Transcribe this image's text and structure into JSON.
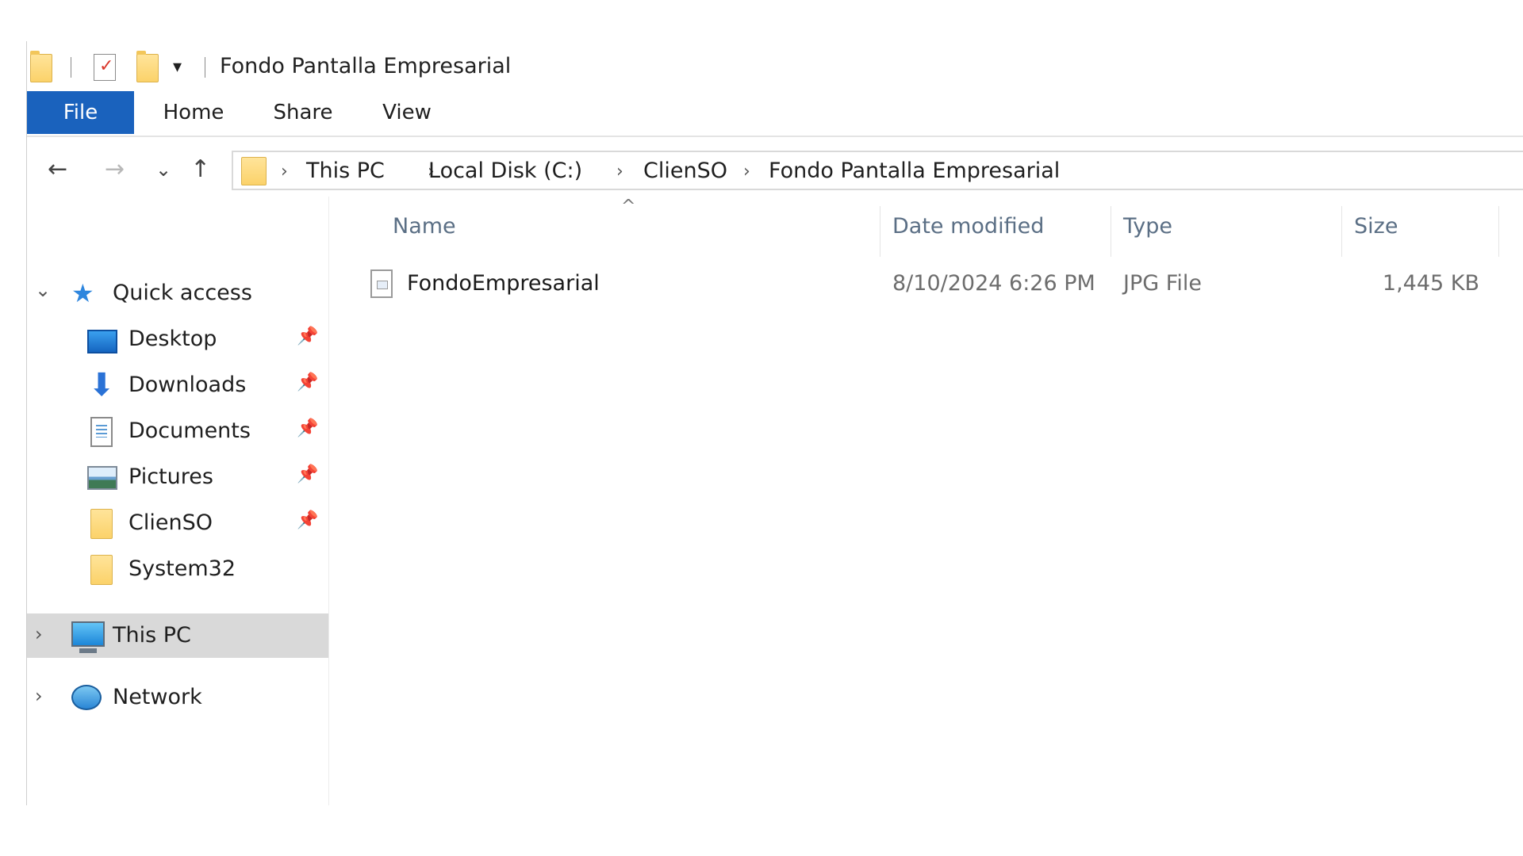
{
  "window": {
    "title": "Fondo Pantalla Empresarial",
    "quick_access_toolbar": {
      "icons": [
        "folder-icon",
        "properties-icon",
        "new-folder-icon",
        "customize-dropdown-icon"
      ]
    }
  },
  "ribbon": {
    "tabs": [
      {
        "label": "File",
        "active": true
      },
      {
        "label": "Home"
      },
      {
        "label": "Share"
      },
      {
        "label": "View"
      }
    ],
    "accent_color": "#1a62bd"
  },
  "address_bar": {
    "back": "←",
    "forward": "→",
    "recent": "⌄",
    "up": "↑",
    "separator": "›",
    "breadcrumbs": [
      "This PC",
      "Local Disk (C:)",
      "ClienSO",
      "Fondo Pantalla Empresarial"
    ]
  },
  "nav_pane": {
    "quick_access": {
      "label": "Quick access",
      "expanded_glyph": "⌄",
      "items": [
        {
          "label": "Desktop",
          "icon": "desktop-icon",
          "pinned": true
        },
        {
          "label": "Downloads",
          "icon": "download-icon",
          "pinned": true
        },
        {
          "label": "Documents",
          "icon": "documents-icon",
          "pinned": true
        },
        {
          "label": "Pictures",
          "icon": "pictures-icon",
          "pinned": true
        },
        {
          "label": "ClienSO",
          "icon": "folder-icon",
          "pinned": true
        },
        {
          "label": "System32",
          "icon": "folder-icon",
          "pinned": false
        }
      ]
    },
    "this_pc": {
      "label": "This PC",
      "selected": true,
      "collapsed_glyph": "›"
    },
    "network": {
      "label": "Network",
      "collapsed_glyph": "›"
    },
    "pin_glyph": "📌",
    "star_glyph": "★",
    "download_glyph": "⬇"
  },
  "file_list": {
    "sort_indicator": "^",
    "columns": [
      "Name",
      "Date modified",
      "Type",
      "Size"
    ],
    "rows": [
      {
        "name": "FondoEmpresarial",
        "date_modified": "8/10/2024 6:26 PM",
        "type": "JPG File",
        "size": "1,445 KB"
      }
    ]
  }
}
